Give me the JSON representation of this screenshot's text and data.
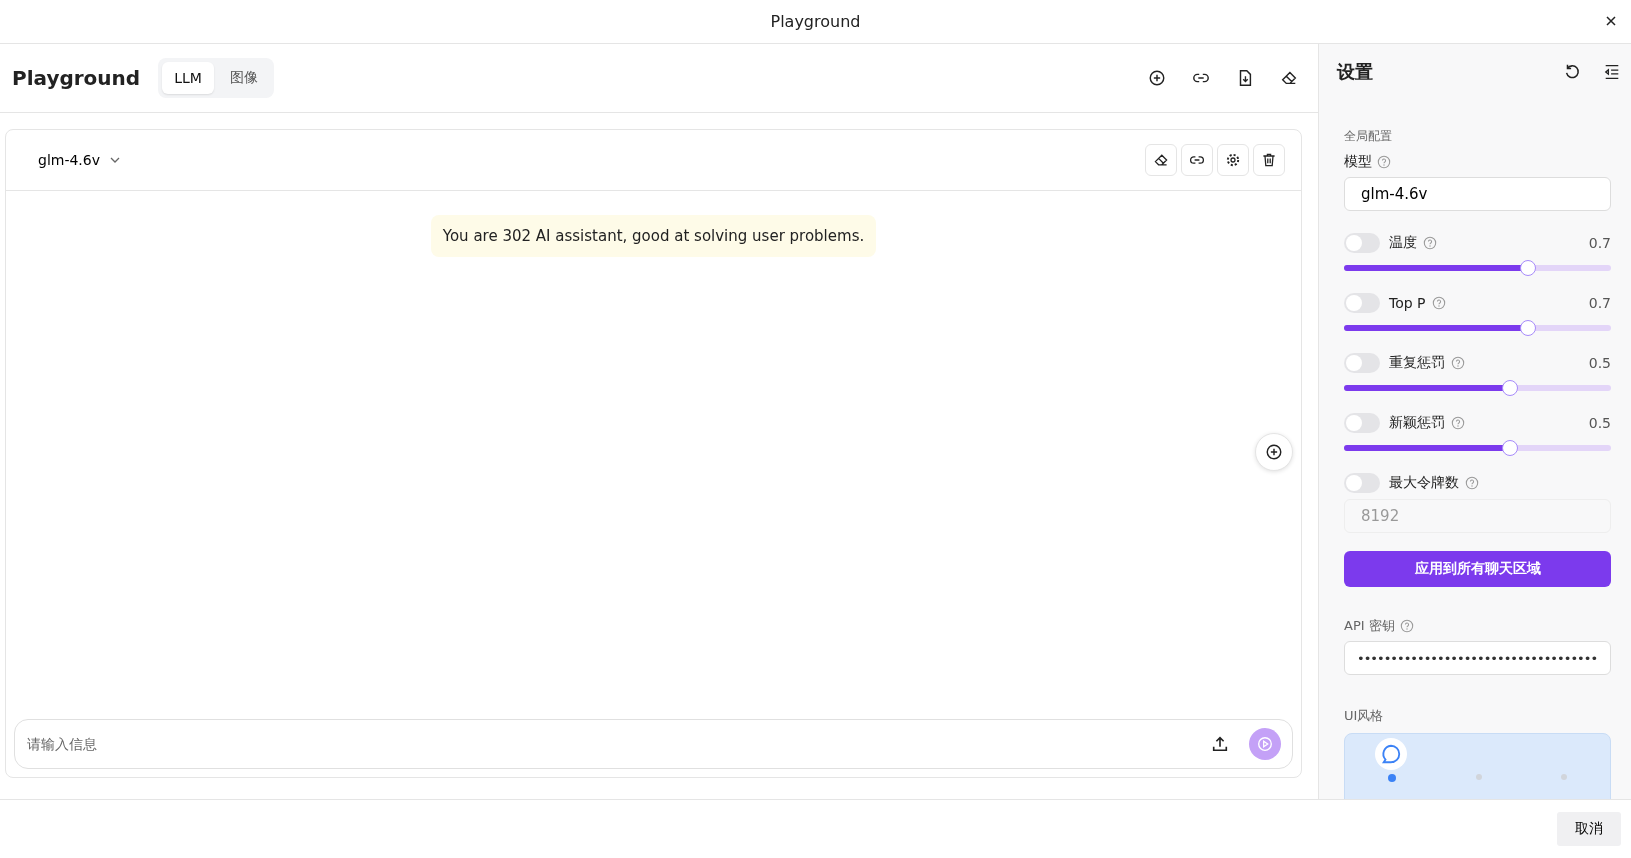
{
  "window": {
    "title": "Playground"
  },
  "header": {
    "title": "Playground",
    "tabs": [
      {
        "label": "LLM",
        "selected": true
      },
      {
        "label": "图像",
        "selected": false
      }
    ]
  },
  "chat": {
    "model": "glm-4.6v",
    "system_prompt": "You are 302 AI assistant, good at solving user problems.",
    "input": {
      "placeholder": "请输入信息"
    }
  },
  "settings": {
    "title": "设置",
    "section": "全局配置",
    "model_label": "模型",
    "model_value": "glm-4.6v",
    "params": [
      {
        "name": "温度",
        "on": false,
        "reading": "0.7",
        "level": 0.69
      },
      {
        "name": "Top P",
        "on": false,
        "reading": "0.7",
        "level": 0.69
      },
      {
        "name": "重复惩罚",
        "on": false,
        "reading": "0.5",
        "level": 0.62
      },
      {
        "name": "新颖惩罚",
        "on": false,
        "reading": "0.5",
        "level": 0.62
      }
    ],
    "max_tokens": {
      "name": "最大令牌数",
      "on": false,
      "value": "8192",
      "disabled": true
    },
    "apply_button": "应用到所有聊天区域",
    "api_key_label": "API 密钥",
    "api_key_value": "••••••••••••••••••••••••••••••••••••",
    "ui_style_label": "UI风格",
    "ui_styles": [
      {
        "selected": true
      },
      {
        "selected": false
      },
      {
        "selected": false
      }
    ]
  },
  "footer": {
    "cancel": "取消"
  }
}
